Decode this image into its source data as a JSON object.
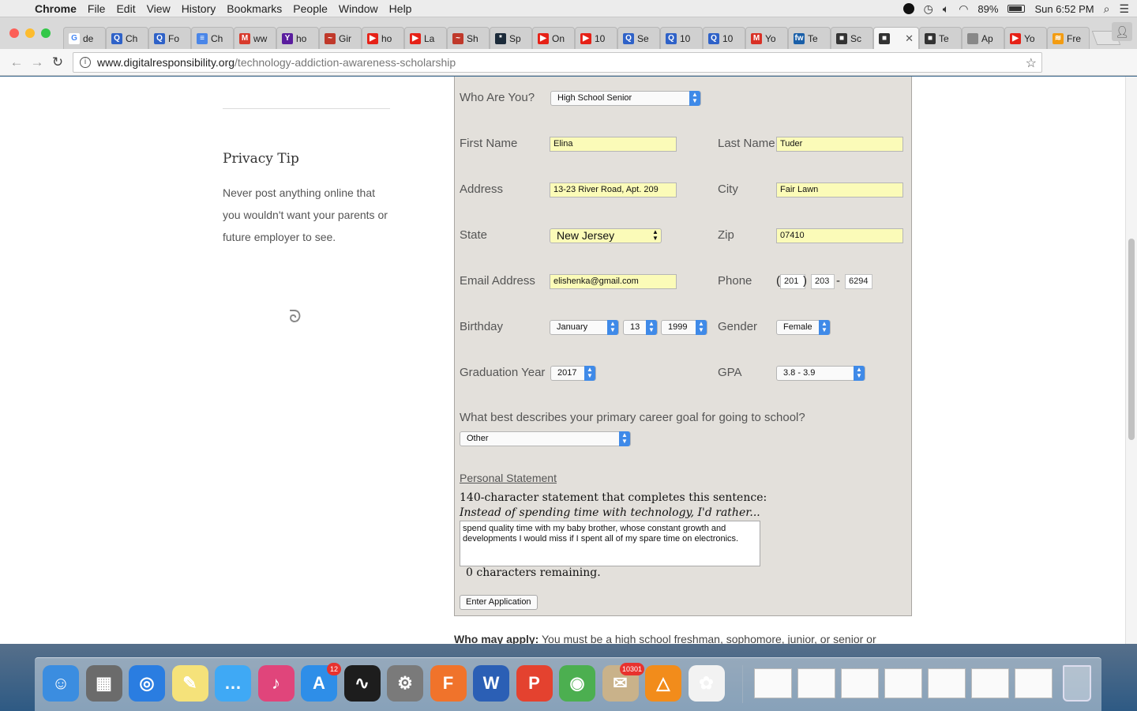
{
  "menubar": {
    "app": "Chrome",
    "menus": [
      "File",
      "Edit",
      "View",
      "History",
      "Bookmarks",
      "People",
      "Window",
      "Help"
    ],
    "battery": "89%",
    "clock": "Sun 6:52 PM"
  },
  "tabs": [
    {
      "label": "de",
      "icon": "google-icon",
      "color": "#ffffff"
    },
    {
      "label": "Ch",
      "icon": "quora-icon",
      "color": "#2f62c8"
    },
    {
      "label": "Fo",
      "icon": "quora-icon",
      "color": "#2f62c8"
    },
    {
      "label": "Ch",
      "icon": "docs-icon",
      "color": "#4a86e8"
    },
    {
      "label": "ww",
      "icon": "m-icon",
      "color": "#d83a2c"
    },
    {
      "label": "ho",
      "icon": "yahoo-icon",
      "color": "#5a1d9e"
    },
    {
      "label": "Gir",
      "icon": "bird-icon",
      "color": "#c0392b"
    },
    {
      "label": "ho",
      "icon": "youtube-icon",
      "color": "#e62117"
    },
    {
      "label": "La",
      "icon": "youtube-icon",
      "color": "#e62117"
    },
    {
      "label": "Sh",
      "icon": "bird-icon",
      "color": "#c0392b"
    },
    {
      "label": "Sp",
      "icon": "snowflake-icon",
      "color": "#1c2b3a"
    },
    {
      "label": "On",
      "icon": "youtube-icon",
      "color": "#e62117"
    },
    {
      "label": "10",
      "icon": "youtube-icon",
      "color": "#e62117"
    },
    {
      "label": "Se",
      "icon": "quora-icon",
      "color": "#2f62c8"
    },
    {
      "label": "10",
      "icon": "quora-icon",
      "color": "#2f62c8"
    },
    {
      "label": "10",
      "icon": "quora-icon",
      "color": "#2f62c8"
    },
    {
      "label": "Yo",
      "icon": "gmail-icon",
      "color": "#d93025"
    },
    {
      "label": "Te",
      "icon": "fw-icon",
      "color": "#1a5fa8"
    },
    {
      "label": "Sc",
      "icon": "cube-icon",
      "color": "#333333"
    },
    {
      "label": "",
      "icon": "cube-icon",
      "color": "#333333",
      "active": true
    },
    {
      "label": "Te",
      "icon": "cube-icon",
      "color": "#333333"
    },
    {
      "label": "Ap",
      "icon": "apple-icon",
      "color": "#888888"
    },
    {
      "label": "Yo",
      "icon": "youtube-icon",
      "color": "#e62117"
    },
    {
      "label": "Fre",
      "icon": "rss-icon",
      "color": "#f39c12"
    }
  ],
  "url": {
    "host": "www.digitalresponsibility.org",
    "path": "/technology-addiction-awareness-scholarship"
  },
  "sidebar": {
    "heading": "Privacy Tip",
    "text": "Never post anything online that you wouldn't want your parents or future employer to see."
  },
  "form": {
    "who_label": "Who Are You?",
    "who_value": "High School Senior",
    "first_name_label": "First Name",
    "first_name": "Elina",
    "last_name_label": "Last Name",
    "last_name": "Tuder",
    "address_label": "Address",
    "address": "13-23 River Road, Apt. 209",
    "city_label": "City",
    "city": "Fair Lawn",
    "state_label": "State",
    "state": "New Jersey",
    "zip_label": "Zip",
    "zip": "07410",
    "email_label": "Email Address",
    "email": "elishenka@gmail.com",
    "phone_label": "Phone",
    "phone_area": "201",
    "phone_prefix": "203",
    "phone_line": "6294",
    "paren_open": "(",
    "paren_close": ")",
    "dash": "-",
    "birthday_label": "Birthday",
    "birth_month": "January",
    "birth_day": "13",
    "birth_year": "1999",
    "gender_label": "Gender",
    "gender": "Female",
    "grad_label": "Graduation Year",
    "grad_year": "2017",
    "gpa_label": "GPA",
    "gpa": "3.8 - 3.9",
    "career_question": "What best describes your primary career goal for going to school?",
    "career_value": "Other",
    "statement_heading": "Personal Statement",
    "statement_intro": "140-character statement that completes this sentence:",
    "statement_prompt": "Instead of spending time with technology, I'd rather...",
    "statement_text": "spend quality time with my baby brother, whose constant growth and developments I would miss if I spent all of my spare time on electronics.",
    "remaining": "0 characters remaining.",
    "submit_label": "Enter Application"
  },
  "who_may_apply": {
    "label": "Who may apply:",
    "text": "You must be a high school freshman, sophomore, junior, or senior or"
  },
  "dock": {
    "app_store_badge": "12",
    "mail_badge": "10301",
    "icons": [
      "finder-icon",
      "calculator-icon",
      "safari-icon",
      "notes-icon",
      "messages-icon",
      "itunes-icon",
      "app-store-icon",
      "activity-monitor-icon",
      "system-preferences-icon",
      "firefox-icon",
      "word-icon",
      "powerpoint-icon",
      "chrome-icon",
      "mail-icon",
      "vlc-icon",
      "photos-icon"
    ]
  }
}
